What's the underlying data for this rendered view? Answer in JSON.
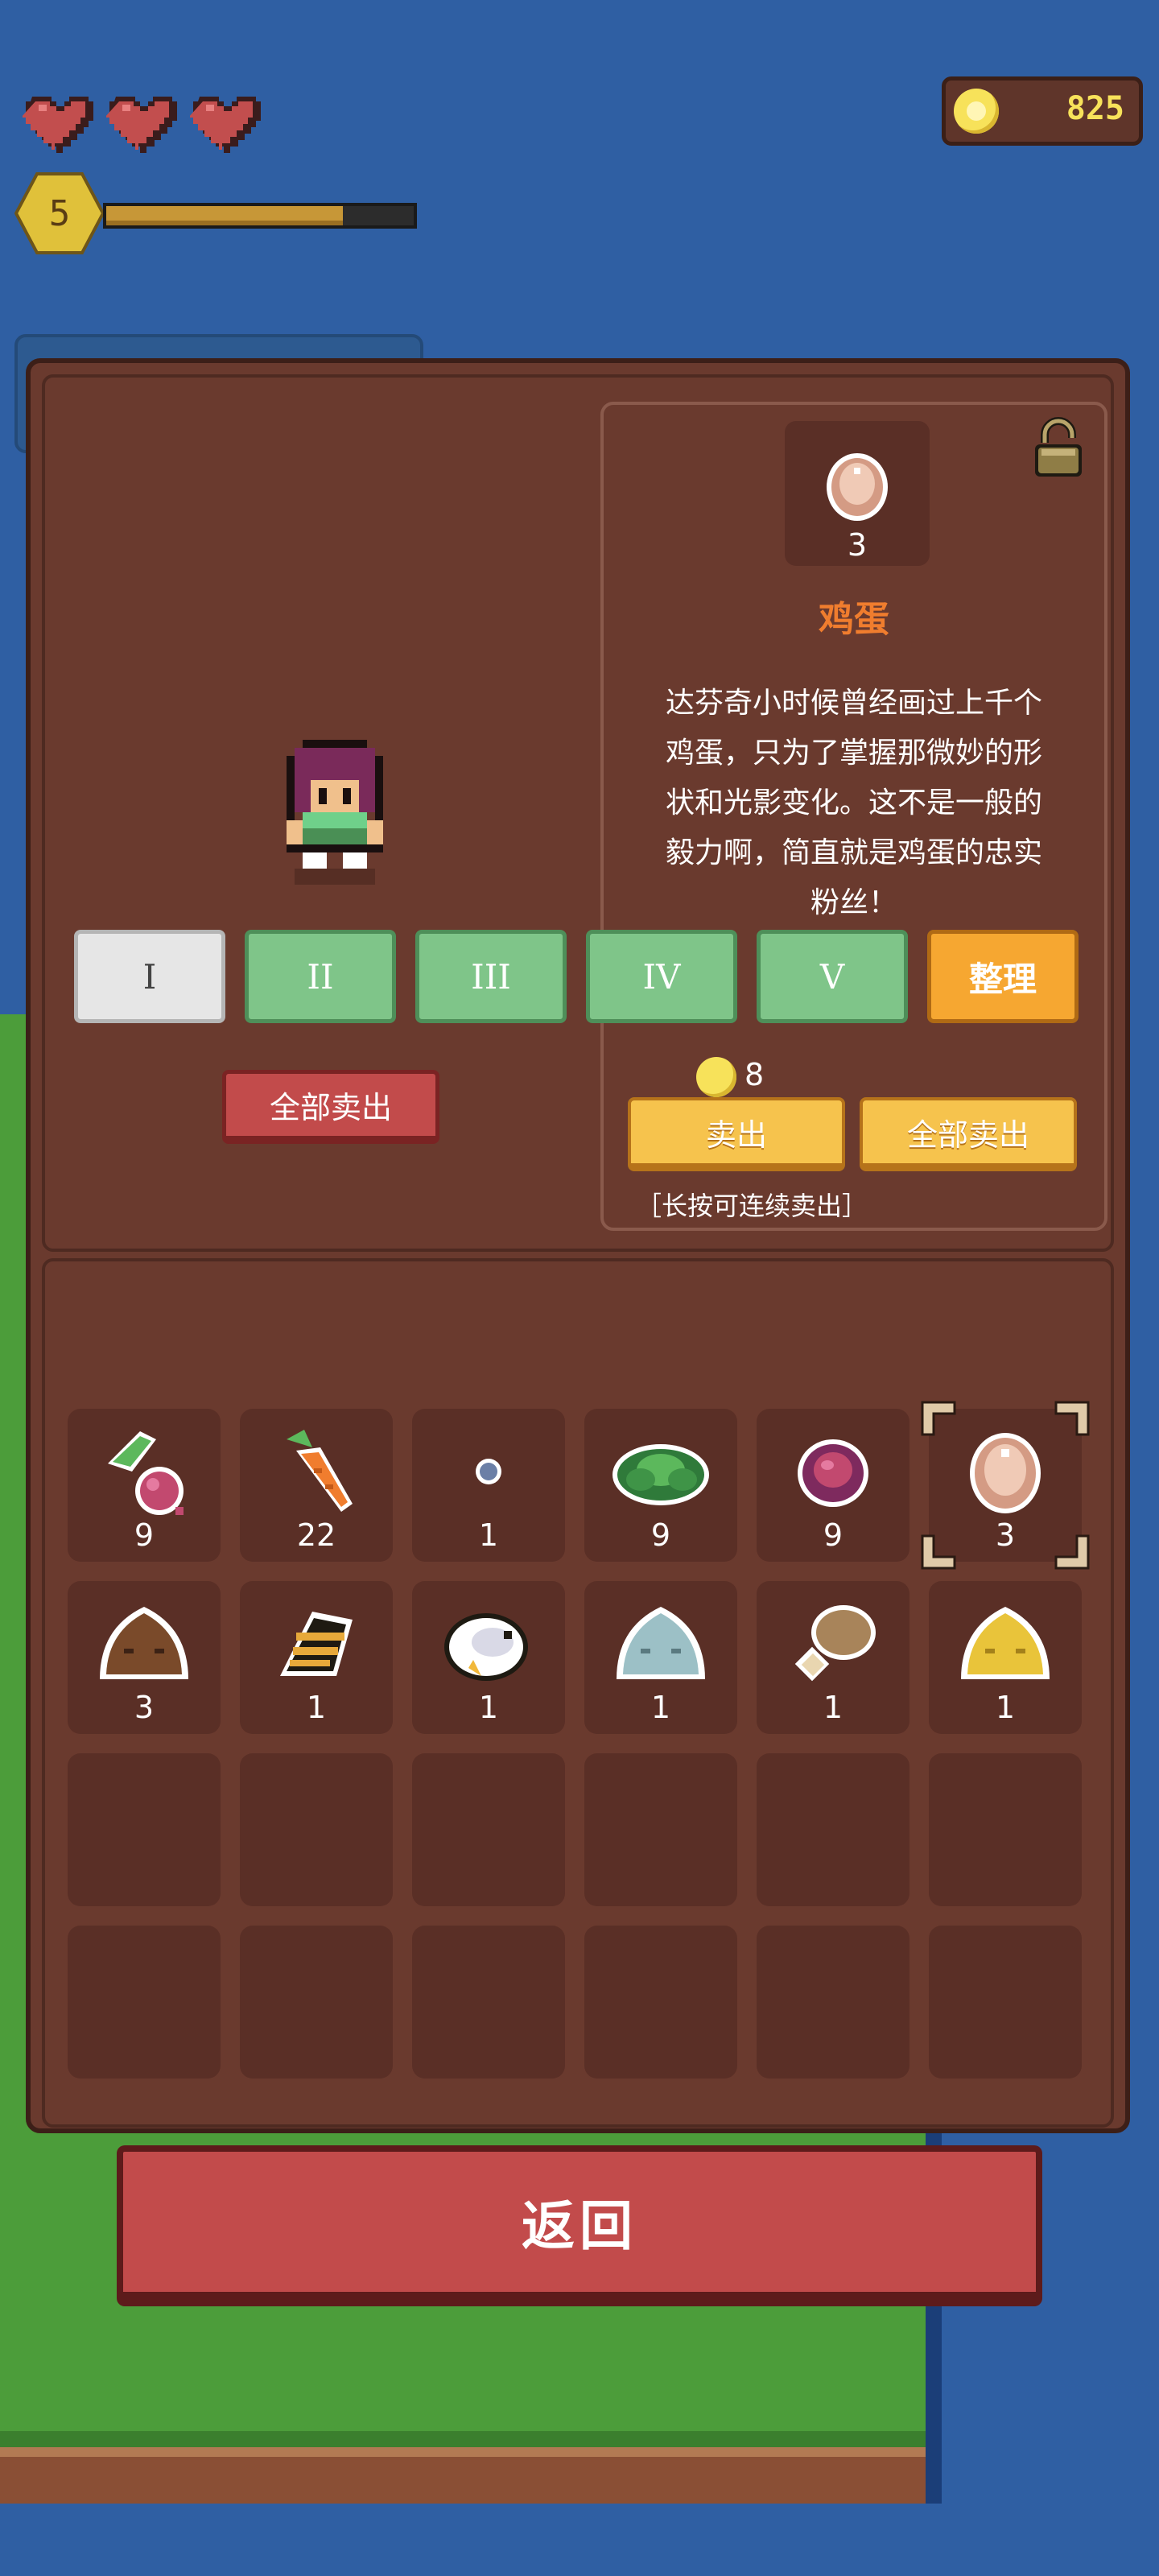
{
  "hud": {
    "hearts": 3,
    "level": "5",
    "xp_progress": 0.77,
    "coins": "825"
  },
  "detail": {
    "item_count": "3",
    "item_name": "鸡蛋",
    "description": "达芬奇小时候曾经画过上千个鸡蛋，只为了掌握那微妙的形状和光影变化。这不是一般的毅力啊，简直就是鸡蛋的忠实粉丝！",
    "price": "8",
    "sell_label": "卖出",
    "sell_all_label": "全部卖出",
    "hint": "［长按可连续卖出］"
  },
  "left": {
    "sell_all_label": "全部卖出"
  },
  "tabs": [
    {
      "label": "I",
      "active": true
    },
    {
      "label": "II",
      "active": false
    },
    {
      "label": "III",
      "active": false
    },
    {
      "label": "IV",
      "active": false
    },
    {
      "label": "V",
      "active": false
    }
  ],
  "sort_label": "整理",
  "inventory": [
    {
      "icon": "turnip-icon",
      "count": "9"
    },
    {
      "icon": "carrot-icon",
      "count": "22"
    },
    {
      "icon": "stone-icon",
      "count": "1"
    },
    {
      "icon": "cabbage-icon",
      "count": "9"
    },
    {
      "icon": "red-onion-icon",
      "count": "9"
    },
    {
      "icon": "egg-icon",
      "count": "3",
      "selected": true
    },
    {
      "icon": "brown-slime-icon",
      "count": "3"
    },
    {
      "icon": "bee-icon",
      "count": "1"
    },
    {
      "icon": "white-bird-icon",
      "count": "1"
    },
    {
      "icon": "blue-slime-icon",
      "count": "1"
    },
    {
      "icon": "drumstick-icon",
      "count": "1"
    },
    {
      "icon": "yellow-slime-icon",
      "count": "1"
    }
  ],
  "back_label": "返回",
  "colors": {
    "panel": "#6a3a2e",
    "slot": "#5a2f26",
    "accent_orange": "#f07d2e",
    "button_red": "#c24b4b",
    "button_yellow": "#f6c34d",
    "tab_green": "#7fc589"
  }
}
